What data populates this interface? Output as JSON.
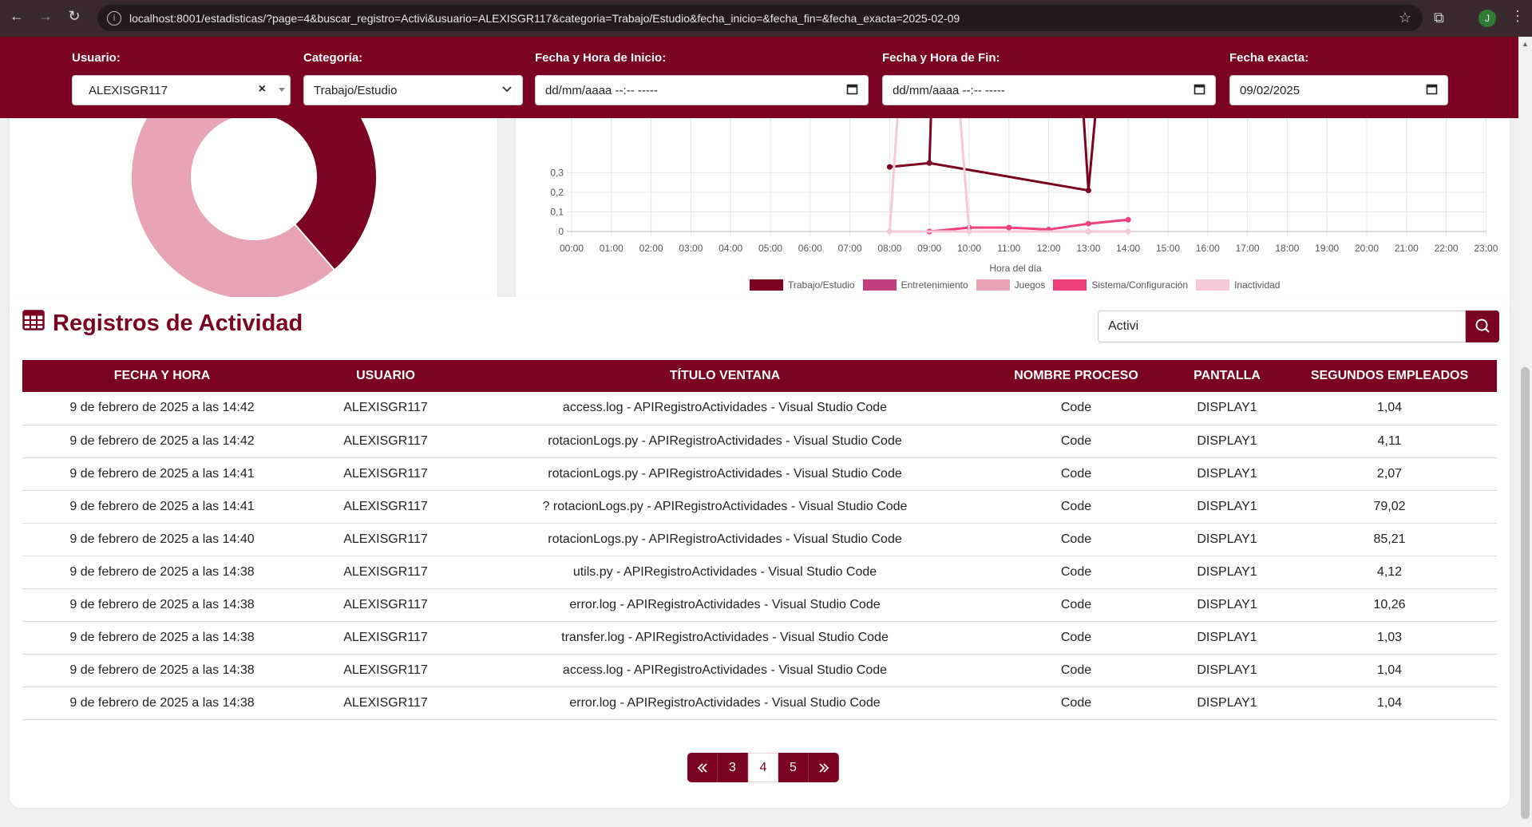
{
  "browser": {
    "url": "localhost:8001/estadisticas/?page=4&buscar_registro=Activi&usuario=ALEXISGR117&categoria=Trabajo/Estudio&fecha_inicio=&fecha_fin=&fecha_exacta=2025-02-09",
    "profile_initial": "J"
  },
  "filters": {
    "usuario_label": "Usuario:",
    "usuario_value": "ALEXISGR117",
    "categoria_label": "Categoría:",
    "categoria_value": "Trabajo/Estudio",
    "inicio_label": "Fecha y Hora de Inicio:",
    "inicio_value": "dd/mm/aaaa --:-- -----",
    "fin_label": "Fecha y Hora de Fin:",
    "fin_value": "dd/mm/aaaa --:-- -----",
    "exacta_label": "Fecha exacta:",
    "exacta_value": "09/02/2025"
  },
  "chart_data": [
    {
      "type": "pie",
      "variant": "donut",
      "partial_view": true,
      "slices": [
        {
          "color": "#7b0220",
          "fraction": 0.34
        },
        {
          "color": "#e8a3b6",
          "fraction": 0.62
        },
        {
          "color": "#f7d1dc",
          "fraction": 0.04
        }
      ]
    },
    {
      "type": "line",
      "xlabel": "Hora del día",
      "ylabel": "",
      "x": [
        "00:00",
        "01:00",
        "02:00",
        "03:00",
        "04:00",
        "05:00",
        "06:00",
        "07:00",
        "08:00",
        "09:00",
        "10:00",
        "11:00",
        "12:00",
        "13:00",
        "14:00",
        "15:00",
        "16:00",
        "17:00",
        "18:00",
        "19:00",
        "20:00",
        "21:00",
        "22:00",
        "23:00"
      ],
      "y_ticks": [
        "0",
        "0,1",
        "0,2",
        "0,3"
      ],
      "ylim_visible": [
        0,
        0.3
      ],
      "legend_position": "bottom",
      "series": [
        {
          "name": "Trabajo/Estudio",
          "color": "#7b0220",
          "points": [
            [
              "08:00",
              0.33
            ],
            [
              "09:00",
              0.35
            ],
            [
              "13:00",
              0.21
            ]
          ]
        },
        {
          "name": "Entretenimiento",
          "color": "#c2407e",
          "points": [
            [
              "13:00",
              0.0
            ]
          ]
        },
        {
          "name": "Juegos",
          "color": "#e8a3b6",
          "points": []
        },
        {
          "name": "Sistema/Configuración",
          "color": "#f0407a",
          "points": [
            [
              "09:00",
              0.0
            ],
            [
              "10:00",
              0.02
            ],
            [
              "11:00",
              0.02
            ],
            [
              "12:00",
              0.01
            ],
            [
              "13:00",
              0.04
            ],
            [
              "14:00",
              0.06
            ]
          ]
        },
        {
          "name": "Inactividad",
          "color": "#f7c8d6",
          "points": [
            [
              "08:00",
              0.0
            ],
            [
              "10:00",
              0.0
            ],
            [
              "13:00",
              0.0
            ],
            [
              "14:00",
              0.0
            ]
          ]
        }
      ]
    }
  ],
  "registros": {
    "title": "Registros de Actividad",
    "search_value": "Activi",
    "headers": [
      "FECHA Y HORA",
      "USUARIO",
      "TÍTULO VENTANA",
      "NOMBRE PROCESO",
      "PANTALLA",
      "SEGUNDOS EMPLEADOS"
    ],
    "rows": [
      [
        "9 de febrero de 2025 a las 14:42",
        "ALEXISGR117",
        "access.log - APIRegistroActividades - Visual Studio Code",
        "Code",
        "DISPLAY1",
        "1,04"
      ],
      [
        "9 de febrero de 2025 a las 14:42",
        "ALEXISGR117",
        "rotacionLogs.py - APIRegistroActividades - Visual Studio Code",
        "Code",
        "DISPLAY1",
        "4,11"
      ],
      [
        "9 de febrero de 2025 a las 14:41",
        "ALEXISGR117",
        "rotacionLogs.py - APIRegistroActividades - Visual Studio Code",
        "Code",
        "DISPLAY1",
        "2,07"
      ],
      [
        "9 de febrero de 2025 a las 14:41",
        "ALEXISGR117",
        "? rotacionLogs.py - APIRegistroActividades - Visual Studio Code",
        "Code",
        "DISPLAY1",
        "79,02"
      ],
      [
        "9 de febrero de 2025 a las 14:40",
        "ALEXISGR117",
        "rotacionLogs.py - APIRegistroActividades - Visual Studio Code",
        "Code",
        "DISPLAY1",
        "85,21"
      ],
      [
        "9 de febrero de 2025 a las 14:38",
        "ALEXISGR117",
        "utils.py - APIRegistroActividades - Visual Studio Code",
        "Code",
        "DISPLAY1",
        "4,12"
      ],
      [
        "9 de febrero de 2025 a las 14:38",
        "ALEXISGR117",
        "error.log - APIRegistroActividades - Visual Studio Code",
        "Code",
        "DISPLAY1",
        "10,26"
      ],
      [
        "9 de febrero de 2025 a las 14:38",
        "ALEXISGR117",
        "transfer.log - APIRegistroActividades - Visual Studio Code",
        "Code",
        "DISPLAY1",
        "1,03"
      ],
      [
        "9 de febrero de 2025 a las 14:38",
        "ALEXISGR117",
        "access.log - APIRegistroActividades - Visual Studio Code",
        "Code",
        "DISPLAY1",
        "1,04"
      ],
      [
        "9 de febrero de 2025 a las 14:38",
        "ALEXISGR117",
        "error.log - APIRegistroActividades - Visual Studio Code",
        "Code",
        "DISPLAY1",
        "1,04"
      ]
    ]
  },
  "pagination": {
    "first_icon": "double-chevron-left-icon",
    "pages": [
      "3",
      "4",
      "5"
    ],
    "current": "4",
    "last_icon": "double-chevron-right-icon"
  }
}
